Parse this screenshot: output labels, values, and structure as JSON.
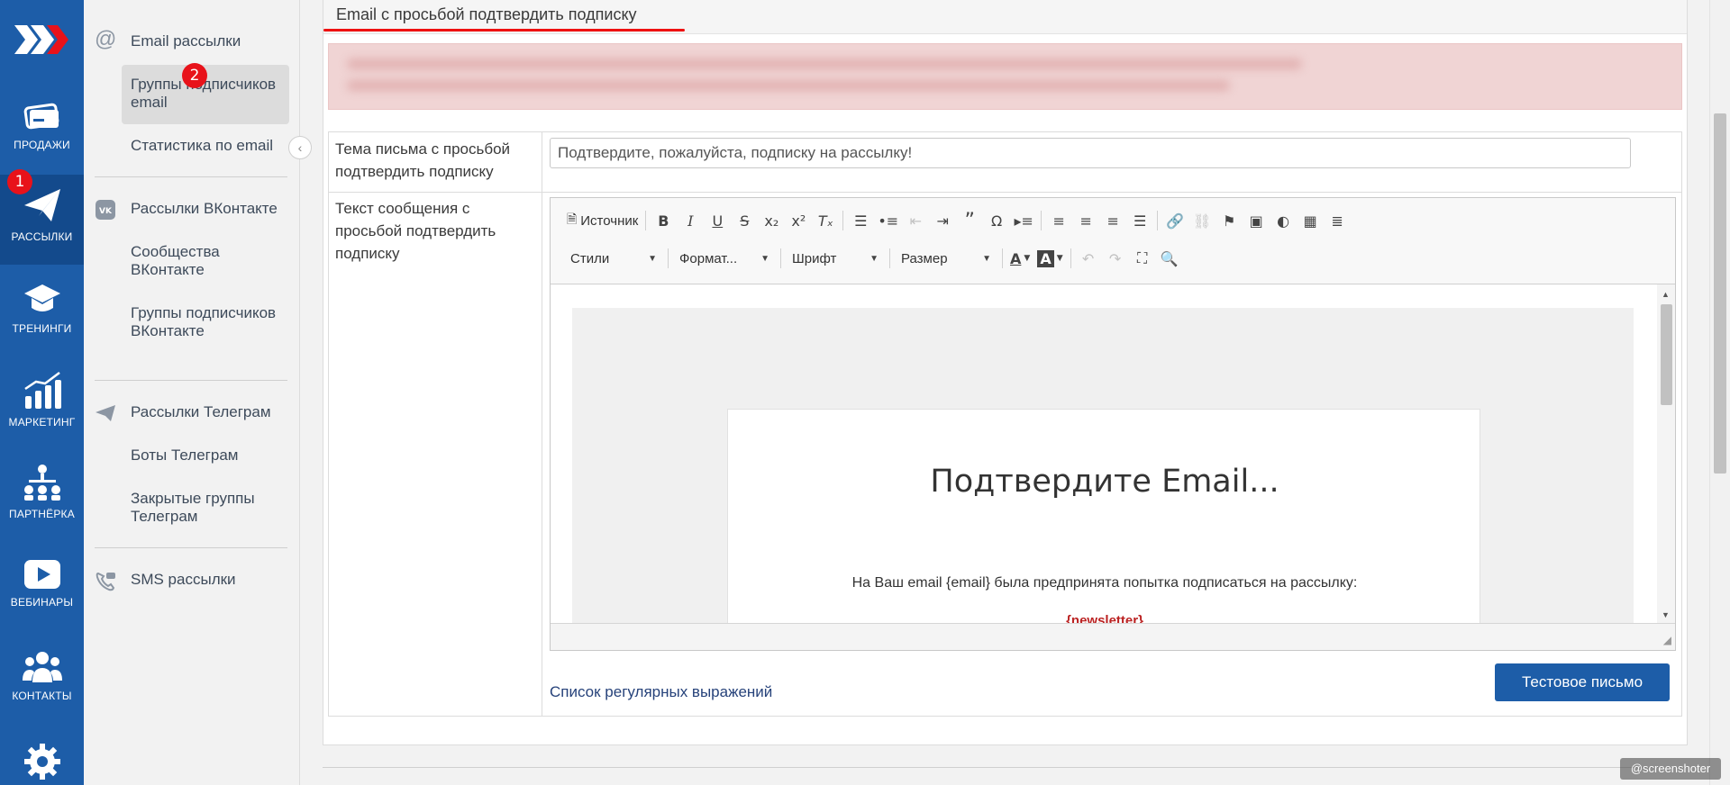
{
  "rail": {
    "items": [
      {
        "label": "ПРОДАЖИ",
        "icon": "card-icon"
      },
      {
        "label": "РАССЫЛКИ",
        "icon": "paper-plane-icon",
        "badge": "1"
      },
      {
        "label": "ТРЕНИНГИ",
        "icon": "graduation-cap-icon"
      },
      {
        "label": "МАРКЕТИНГ",
        "icon": "growth-chart-icon"
      },
      {
        "label": "ПАРТНЁРКА",
        "icon": "network-icon"
      },
      {
        "label": "ВЕБИНАРЫ",
        "icon": "play-icon"
      },
      {
        "label": "КОНТАКТЫ",
        "icon": "people-icon"
      },
      {
        "label": "",
        "icon": "gear-icon"
      }
    ]
  },
  "menu": {
    "email_newsletters": "Email рассылки",
    "email_groups": "Группы подписчиков email",
    "email_groups_badge": "2",
    "email_stats": "Статистика по email",
    "vk_newsletters": "Рассылки ВКонтакте",
    "vk_communities": "Сообщества ВКонтакте",
    "vk_groups": "Группы подписчиков ВКонтакте",
    "tg_newsletters": "Рассылки Телеграм",
    "tg_bots": "Боты Телеграм",
    "tg_groups": "Закрытые группы Телеграм",
    "sms": "SMS рассылки"
  },
  "panel": {
    "title": "Email с просьбой подтвердить подписку",
    "subject_label": "Тема письма с просьбой подтвердить подписку",
    "subject_value": "Подтвердите, пожалуйста, подписку на рассылку!",
    "body_label": "Текст сообщения с просьбой подтвердить подписку",
    "regex_link": "Список регулярных выражений",
    "test_button": "Тестовое письмо"
  },
  "editor": {
    "source_label": "Источник",
    "combo_styles": "Стили",
    "combo_format": "Формат...",
    "combo_font": "Шрифт",
    "combo_size": "Размер"
  },
  "email_preview": {
    "heading": "Подтвердите Email...",
    "body": "На Ваш email {email} была предпринята попытка подписаться на рассылку:",
    "newsletter_var": "{newsletter}"
  },
  "watermark": "@screenshoter",
  "colors": {
    "brand": "#1d5da8",
    "badge": "#e8121a",
    "underline": "#e11111"
  }
}
